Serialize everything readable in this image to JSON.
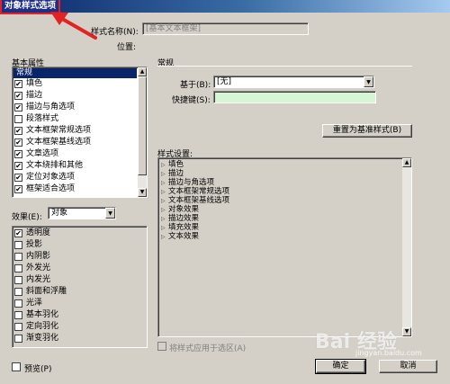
{
  "window": {
    "title": "对象样式选项"
  },
  "style_name": {
    "label": "样式名称(N):",
    "value": "[基本文本框架]"
  },
  "location": {
    "label": "位置:"
  },
  "basic_attributes": {
    "heading": "基本属性",
    "items": [
      {
        "label": "常规",
        "checkbox": false,
        "selected": true
      },
      {
        "label": "填色",
        "checkbox": true,
        "checked": true
      },
      {
        "label": "描边",
        "checkbox": true,
        "checked": true
      },
      {
        "label": "描边与角选项",
        "checkbox": true,
        "checked": true
      },
      {
        "label": "段落样式",
        "checkbox": true,
        "checked": false
      },
      {
        "label": "文本框架常规选项",
        "checkbox": true,
        "checked": true
      },
      {
        "label": "文本框架基线选项",
        "checkbox": true,
        "checked": true
      },
      {
        "label": "文章选项",
        "checkbox": true,
        "checked": true
      },
      {
        "label": "文本绕排和其他",
        "checkbox": true,
        "checked": true
      },
      {
        "label": "定位对象选项",
        "checkbox": true,
        "checked": true
      },
      {
        "label": "框架适合选项",
        "checkbox": true,
        "checked": true
      }
    ]
  },
  "effects": {
    "label": "效果(E):",
    "selected": "对象",
    "items": [
      {
        "label": "透明度",
        "checked": true
      },
      {
        "label": "投影",
        "checked": false
      },
      {
        "label": "内阴影",
        "checked": false
      },
      {
        "label": "外发光",
        "checked": false
      },
      {
        "label": "内发光",
        "checked": false
      },
      {
        "label": "斜面和浮雕",
        "checked": false
      },
      {
        "label": "光泽",
        "checked": false
      },
      {
        "label": "基本羽化",
        "checked": false
      },
      {
        "label": "定向羽化",
        "checked": false
      },
      {
        "label": "渐变羽化",
        "checked": false
      }
    ]
  },
  "general": {
    "heading": "常规",
    "based_on_label": "基于(B):",
    "based_on_value": "[无]",
    "shortcut_label": "快捷键(S):",
    "shortcut_value": "",
    "reset_button": "重置为基准样式(B)"
  },
  "style_settings": {
    "heading": "样式设置:",
    "items": [
      "填色",
      "描边",
      "描边与角选项",
      "文本框架常规选项",
      "文本框架基线选项",
      "对象效果",
      "描边效果",
      "填充效果",
      "文本效果"
    ]
  },
  "apply_to_selection": {
    "label": "将样式应用于选区(A)",
    "checked": false
  },
  "preview": {
    "label": "预览(P)",
    "checked": false
  },
  "buttons": {
    "ok": "确定",
    "cancel": "取消"
  },
  "watermark": {
    "brand": "Bai 经验",
    "url": "jingyan.baidu.com"
  },
  "icons": {
    "check": "✔",
    "tree_expand": "▷",
    "dropdown": "▼",
    "scroll_up": "▲",
    "scroll_down": "▼"
  }
}
